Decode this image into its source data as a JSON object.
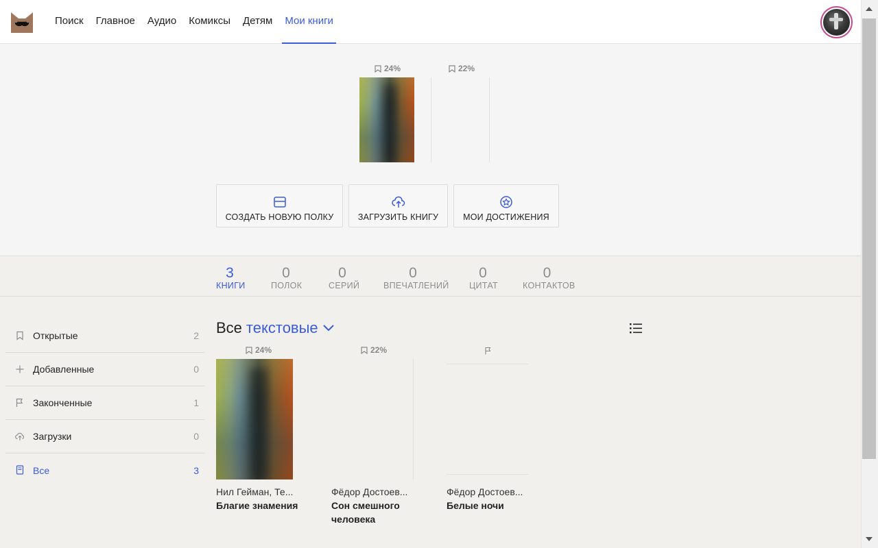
{
  "header": {
    "nav": [
      "Поиск",
      "Главное",
      "Аудио",
      "Комиксы",
      "Детям",
      "Мои книги"
    ],
    "active_nav": "Мои книги"
  },
  "top": {
    "books": [
      {
        "progress": "24%"
      },
      {
        "progress": "22%"
      }
    ],
    "actions": {
      "create_shelf": "СОЗДАТЬ НОВУЮ ПОЛКУ",
      "upload_book": "ЗАГРУЗИТЬ КНИГУ",
      "achievements": "МОИ ДОСТИЖЕНИЯ"
    }
  },
  "stats": [
    {
      "num": "3",
      "label": "КНИГИ"
    },
    {
      "num": "0",
      "label": "ПОЛОК"
    },
    {
      "num": "0",
      "label": "СЕРИЙ"
    },
    {
      "num": "0",
      "label": "ВПЕЧАТЛЕНИЙ"
    },
    {
      "num": "0",
      "label": "ЦИТАТ"
    },
    {
      "num": "0",
      "label": "КОНТАКТОВ"
    }
  ],
  "sidebar": [
    {
      "label": "Открытые",
      "count": "2",
      "icon": "bookmark-icon"
    },
    {
      "label": "Добавленные",
      "count": "0",
      "icon": "plus-icon"
    },
    {
      "label": "Законченные",
      "count": "1",
      "icon": "flag-icon"
    },
    {
      "label": "Загрузки",
      "count": "0",
      "icon": "cloud-upload-icon"
    },
    {
      "label": "Все",
      "count": "3",
      "icon": "book-icon"
    }
  ],
  "list": {
    "prefix": "Все",
    "filter": "текстовые"
  },
  "books": [
    {
      "progress": "24%",
      "author": "Нил Гейман,  Те...",
      "title": "Благие знамения"
    },
    {
      "progress": "22%",
      "author": "Фёдор Достоев...",
      "title": "Сон смешного человека"
    },
    {
      "progress": "",
      "author": "Фёдор Достоев...",
      "title": "Белые ночи"
    }
  ],
  "colors": {
    "accent": "#3b5bdb",
    "avatar_ring": "#c44b8e"
  }
}
